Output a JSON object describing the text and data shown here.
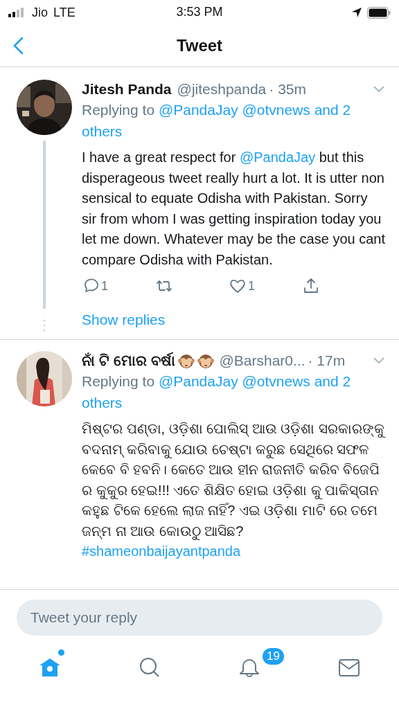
{
  "status_bar": {
    "carrier": "Jio",
    "network": "LTE",
    "time": "3:53 PM"
  },
  "header": {
    "title": "Tweet"
  },
  "tweets": [
    {
      "avatar": {
        "kind": "picture"
      },
      "name": "Jitesh Panda",
      "handle": "@jiteshpanda",
      "time": "· 35m",
      "replying_label": "Replying to",
      "replying_links": [
        "@PandaJay",
        "@otvnews",
        "and 2",
        "others"
      ],
      "body": [
        {
          "kind": "text",
          "text": "I have a great respect for "
        },
        {
          "kind": "mention",
          "text": "@PandaJay"
        },
        {
          "kind": "text",
          "text": " but this disperageous tweet really hurt a lot. It is utter non sensical to equate Odisha with Pakistan. Sorry sir from whom I was getting inspiration today you let me down. Whatever may be the case you cant compare Odisha with Pakistan."
        }
      ],
      "actions": [
        {
          "kind": "reply",
          "count": "1"
        },
        {
          "kind": "retweet"
        },
        {
          "kind": "like",
          "count": "1"
        },
        {
          "kind": "share"
        }
      ],
      "show_replies": "Show replies"
    },
    {
      "avatar": {
        "kind": "picture"
      },
      "name": "ନାଁ ଟି ମୋର ବର୍ଷା",
      "name_icons": [
        {
          "kind": "monkey"
        },
        {
          "kind": "monkey"
        }
      ],
      "handle": "@Barshar0...",
      "time": "· 17m",
      "replying_label": "Replying to",
      "replying_links": [
        "@PandaJay",
        "@otvnews",
        "and 2",
        "others"
      ],
      "body": [
        {
          "kind": "text",
          "text": "ମିଷ୍ଟର ପଣ୍ଡା, ଓଡ଼ିଶା ପୋଲିସ୍ ଆଉ ଓଡ଼ିଶା ସରକାରଙ୍କୁ ବଦନାମ୍ କରିବାକୁ ଯୋଉ ଚେଷ୍ଟା କରୁଛ ସେଥିରେ ସଫଳ କେବେ ବି ହବନି। କେତେ ଆଉ ହୀନ ରାଜନୀତି କରିବ ବିଜେପି ର କୁକୁର ହେଇ!!! ଏତେ ଶିକ୍ଷିତ ହୋଇ ଓଡ଼ିଶା କୁ ପାକିସ୍ତାନ କହୁଛ ଟିକେ ହେଲେ ଲାଜ ନାହିଁ? ଏଇ ଓଡ଼ିଶା ମାଟି ରେ ତମେ ଜନ୍ମ ନା ଆଉ କୋଉଠୁ ଆସିଛ?"
        }
      ],
      "hashtag": "#shameonbaijayantpanda"
    }
  ],
  "reply_box": {
    "placeholder": "Tweet your reply"
  },
  "tabbar": [
    {
      "kind": "home",
      "selected": true,
      "dot": true
    },
    {
      "kind": "search",
      "selected": false
    },
    {
      "kind": "notifications",
      "selected": false,
      "badge": "19"
    },
    {
      "kind": "messages",
      "selected": false
    }
  ]
}
